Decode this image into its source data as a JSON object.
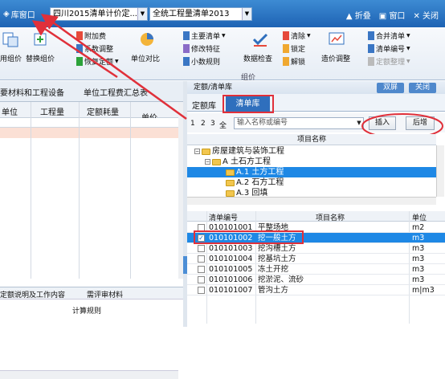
{
  "titlebar": {
    "lib_label": "库窗口",
    "combo1": "四川2015清单计价定...",
    "combo2": "全统工程量清单2013",
    "fold": "折叠",
    "window": "窗口",
    "close": "关闭"
  },
  "ribbon": {
    "reuse": "用组价",
    "replace": "替换组价",
    "add_fee": "附加费",
    "coef_adjust": "系数调整",
    "restore": "恢复定额",
    "compare": "单位对比",
    "main_list": "主要清单",
    "modify_feature": "修改特征",
    "small_rule": "小数规则",
    "data_check": "数据检查",
    "clear": "清除",
    "lock": "锁定",
    "unlock": "解锁",
    "price_adjust": "造价调整",
    "merge_list": "合并清单",
    "list_no": "清单编号",
    "quota_sort": "定额整理",
    "group_label": "组价"
  },
  "left": {
    "tab1": "要材料和工程设备",
    "tab2": "单位工程费汇总表",
    "col_unit": "单位",
    "col_qty": "工程量",
    "col_quota_qty": "定额耗量",
    "col_price": "单价",
    "bottom_tab1": "定额说明及工作内容",
    "bottom_tab2": "需评审材料",
    "bottom_title": "计算规则"
  },
  "right": {
    "title": "定额/清单库",
    "btn_double": "双屏",
    "btn_close": "关闭",
    "tab_quota": "定额库",
    "tab_list": "清单库",
    "levels": [
      "1",
      "2",
      "3",
      "全"
    ],
    "search_placeholder": "输入名称或编号",
    "insert": "插入",
    "append": "后增",
    "tree_header": "项目名称",
    "tree": [
      "房屋建筑与装饰工程",
      "A 土石方工程",
      "A.1 土方工程",
      "A.2 石方工程",
      "A.3 回填"
    ],
    "list_cols": {
      "code": "清单编号",
      "name": "项目名称",
      "unit": "单位"
    },
    "rows": [
      {
        "code": "010101001",
        "name": "平整场地",
        "unit": "m2",
        "checked": false,
        "selected": false
      },
      {
        "code": "010101002",
        "name": "挖一般土方",
        "unit": "m3",
        "checked": true,
        "selected": true
      },
      {
        "code": "010101003",
        "name": "挖沟槽土方",
        "unit": "m3",
        "checked": false,
        "selected": false
      },
      {
        "code": "010101004",
        "name": "挖基坑土方",
        "unit": "m3",
        "checked": false,
        "selected": false
      },
      {
        "code": "010101005",
        "name": "冻土开挖",
        "unit": "m3",
        "checked": false,
        "selected": false
      },
      {
        "code": "010101006",
        "name": "挖淤泥、流砂",
        "unit": "m3",
        "checked": false,
        "selected": false
      },
      {
        "code": "010101007",
        "name": "管沟土方",
        "unit": "m|m3",
        "checked": false,
        "selected": false
      }
    ]
  },
  "colors": {
    "accent": "#1e88e5",
    "annotation": "#e0303a"
  }
}
